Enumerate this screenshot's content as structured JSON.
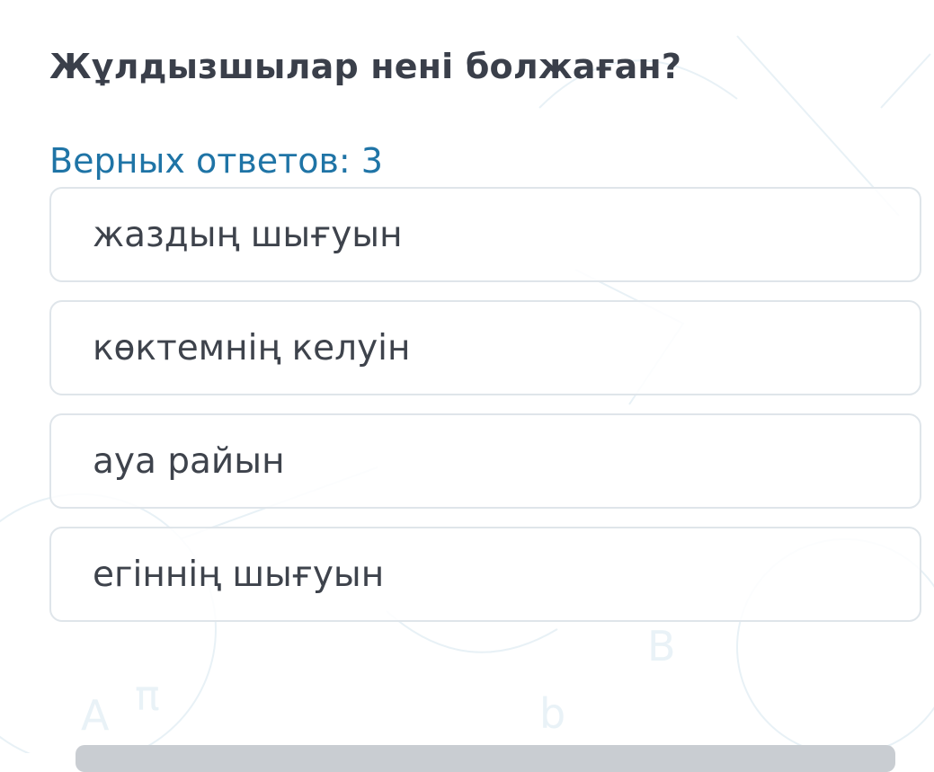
{
  "question": {
    "title": "Жұлдызшылар нені болжаған?",
    "correct_count": "Верных ответов: 3"
  },
  "answers": [
    {
      "label": "жаздың шығуын"
    },
    {
      "label": "көктемнің келуін"
    },
    {
      "label": "ауа райын"
    },
    {
      "label": "егіннің шығуын"
    }
  ],
  "colors": {
    "title": "#3a3f4a",
    "accent": "#1f74a6",
    "option_border": "#dfe5ea",
    "option_text": "#3e434c"
  }
}
